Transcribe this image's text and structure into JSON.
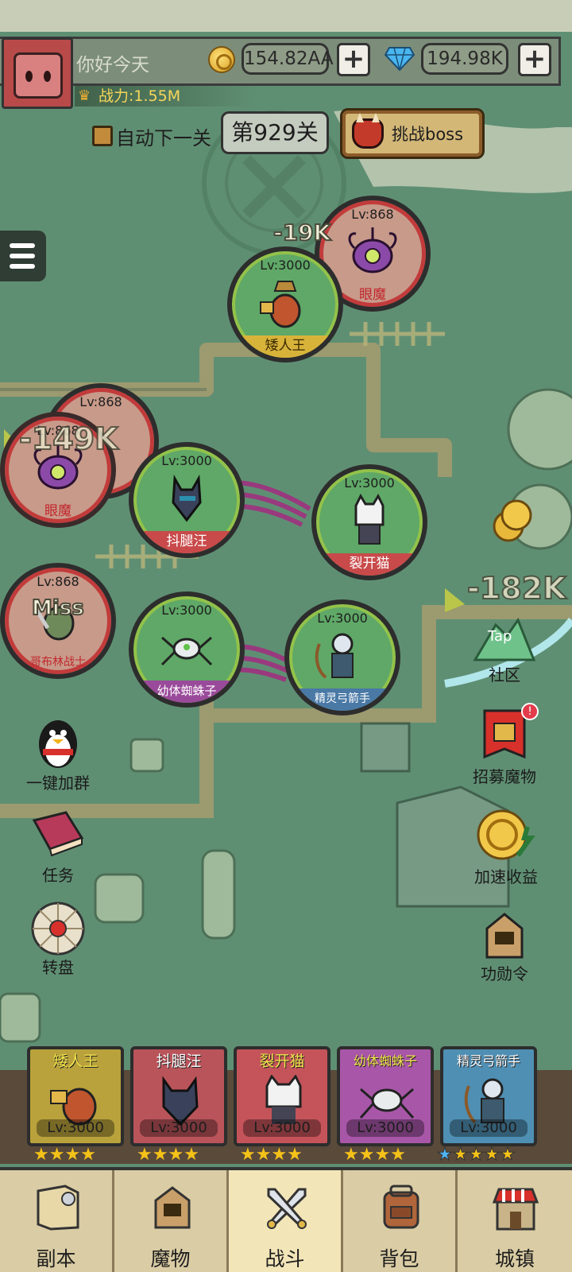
{
  "player": {
    "name": "你好今天",
    "power": "战力:1.55M"
  },
  "currency": {
    "gold": "154.82AA",
    "gems": "194.98K",
    "plus": "+"
  },
  "stage": {
    "auto_next_label": "自动下一关",
    "current": "第929关",
    "boss_button": "挑战boss"
  },
  "allies": [
    {
      "name": "矮人王",
      "level": "Lv:3000",
      "color": "#d8b33a"
    },
    {
      "name": "抖腿汪",
      "level": "Lv:3000",
      "color": "#c94a4a"
    },
    {
      "name": "裂开猫",
      "level": "Lv:3000",
      "color": "#c94a4a"
    },
    {
      "name": "幼体蜘蛛子",
      "level": "Lv:3000",
      "color": "#9a4a9a"
    },
    {
      "name": "精灵弓箭手",
      "level": "Lv:3000",
      "color": "#4a79a6"
    }
  ],
  "enemies": [
    {
      "name": "眼魔",
      "level": "Lv:868"
    },
    {
      "name": "",
      "level": "Lv:868"
    },
    {
      "name": "眼魔",
      "level": "Lv:868"
    },
    {
      "name": "哥布林战士",
      "level": "Lv:868"
    }
  ],
  "damage": {
    "d1": "-19K",
    "d2": "-149K",
    "d3": "-182K",
    "miss": "Miss"
  },
  "side_left": {
    "group": "一键加群",
    "task": "任务",
    "wheel": "转盘"
  },
  "side_right": {
    "tap": "Tap",
    "community": "社区",
    "recruit": "招募魔物",
    "speed": "加速收益",
    "merit": "功勋令"
  },
  "hero_cards": [
    {
      "name": "矮人王",
      "level": "Lv:3000",
      "stars": "★★★★",
      "bg": "#b9a23c"
    },
    {
      "name": "抖腿汪",
      "level": "Lv:3000",
      "stars": "★★★★",
      "bg": "#b9545a"
    },
    {
      "name": "裂开猫",
      "level": "Lv:3000",
      "stars": "★★★★",
      "bg": "#c4545a"
    },
    {
      "name": "幼体蜘蛛子",
      "level": "Lv:3000",
      "stars": "★★★★",
      "bg": "#a857a8"
    },
    {
      "name": "精灵弓箭手",
      "level": "Lv:3000",
      "stars": "★★★★★",
      "bg": "#4f8fb3"
    }
  ],
  "nav": [
    {
      "label": "副本",
      "icon": "map-scroll-icon"
    },
    {
      "label": "魔物",
      "icon": "monster-helmet-icon"
    },
    {
      "label": "战斗",
      "icon": "crossed-swords-icon"
    },
    {
      "label": "背包",
      "icon": "backpack-icon"
    },
    {
      "label": "城镇",
      "icon": "shop-building-icon"
    }
  ]
}
